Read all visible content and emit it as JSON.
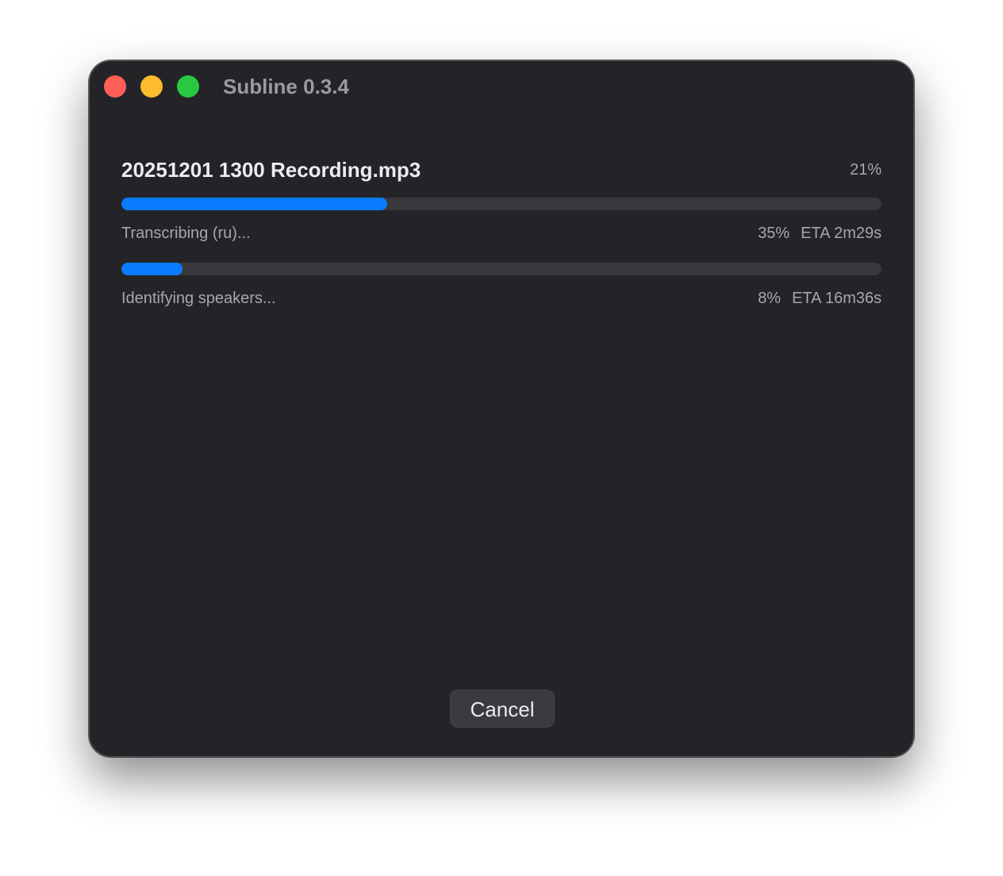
{
  "window": {
    "title": "Subline 0.3.4"
  },
  "file": {
    "name": "20251201 1300 Recording.mp3",
    "overall_percent": "21%"
  },
  "tasks": [
    {
      "label": "Transcribing (ru)...",
      "percent": "35%",
      "eta": "ETA 2m29s",
      "progress": 0.35
    },
    {
      "label": "Identifying speakers...",
      "percent": "8%",
      "eta": "ETA 16m36s",
      "progress": 0.08
    }
  ],
  "buttons": {
    "cancel_label": "Cancel"
  },
  "colors": {
    "accent": "#0a7cff",
    "window_bg": "#242428",
    "close": "#ff5f57",
    "minimize": "#febc2e",
    "maximize": "#28c840"
  }
}
